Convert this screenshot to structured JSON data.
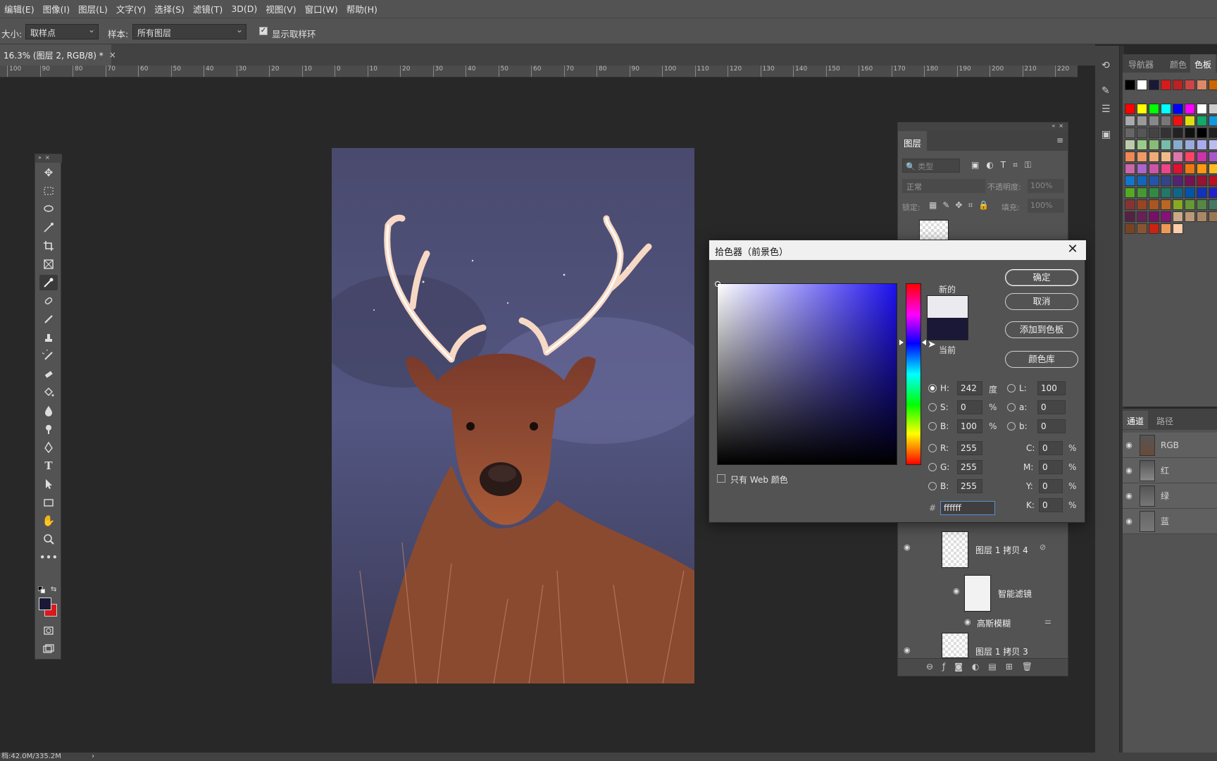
{
  "menu": [
    "编辑(E)",
    "图像(I)",
    "图层(L)",
    "文字(Y)",
    "选择(S)",
    "滤镜(T)",
    "3D(D)",
    "视图(V)",
    "窗口(W)",
    "帮助(H)"
  ],
  "options": {
    "size_label": "大小:",
    "size_value": "取样点",
    "sample_label": "样本:",
    "sample_value": "所有图层",
    "show_ring_label": "显示取样环",
    "show_ring_checked": true
  },
  "document_tab": {
    "title": "16.3% (图层 2, RGB/8) *",
    "close": "×"
  },
  "ruler_ticks": [
    "100",
    "90",
    "80",
    "70",
    "60",
    "50",
    "40",
    "30",
    "20",
    "10",
    "0",
    "10",
    "20",
    "30",
    "40",
    "50",
    "60",
    "70",
    "80",
    "90",
    "100",
    "110",
    "120",
    "130",
    "140",
    "150",
    "160",
    "170",
    "180",
    "190",
    "200",
    "210",
    "220"
  ],
  "right_panel": {
    "tabs": [
      "导航器",
      "颜色",
      "色板"
    ],
    "channel_tabs": [
      "通道",
      "路径"
    ],
    "channels": [
      "RGB",
      "红",
      "绿",
      "蓝"
    ]
  },
  "layers_panel": {
    "title": "图层",
    "search_placeholder": "类型",
    "blend_mode": "正常",
    "opacity_label": "不透明度:",
    "opacity_value": "100%",
    "lock_label": "锁定:",
    "fill_label": "填充:",
    "fill_value": "100%",
    "layers": [
      {
        "name": "图层 1 拷贝 4"
      },
      {
        "name": "智能滤镜"
      },
      {
        "name": "高斯模糊"
      },
      {
        "name": "图层 1 拷贝 3"
      }
    ]
  },
  "color_picker": {
    "title": "拾色器（前景色）",
    "new_label": "新的",
    "current_label": "当前",
    "new_color": "#ebebef",
    "current_color": "#1a1836",
    "buttons": {
      "ok": "确定",
      "cancel": "取消",
      "add_swatch": "添加到色板",
      "libraries": "颜色库"
    },
    "web_only_label": "只有 Web 颜色",
    "fields": {
      "H": "242",
      "H_unit": "度",
      "S": "0",
      "S_unit": "%",
      "B": "100",
      "B_unit": "%",
      "R": "255",
      "G": "255",
      "B2": "255",
      "L": "100",
      "a": "0",
      "b": "0",
      "C": "0",
      "M": "0",
      "Y": "0",
      "K": "0",
      "percent": "%",
      "hex": "ffffff"
    },
    "field_labels": {
      "H": "H:",
      "S": "S:",
      "B": "B:",
      "R": "R:",
      "G": "G:",
      "B2": "B:",
      "L": "L:",
      "a": "a:",
      "b": "b:",
      "C": "C:",
      "M": "M:",
      "Y": "Y:",
      "K": "K:",
      "hash": "#"
    }
  },
  "status": {
    "doc_size": "档:42.0M/335.2M",
    "arrow": "›"
  },
  "colors": {
    "foreground": "#1a1836",
    "background": "#d71a1a"
  }
}
